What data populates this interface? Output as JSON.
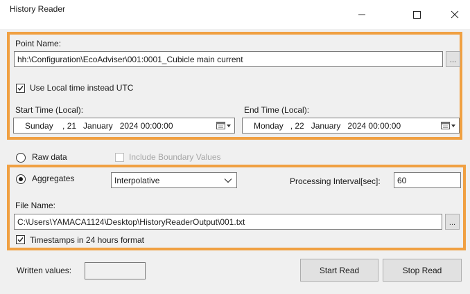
{
  "window": {
    "title": "History Reader",
    "controls": [
      "minimize-icon",
      "maximize-icon",
      "close-icon"
    ]
  },
  "point": {
    "label": "Point Name:",
    "value": "hh:\\Configuration\\EcoAdviser\\001:0001_Cubicle main current",
    "browse_label": "..."
  },
  "local_time": {
    "label": "Use Local time instead UTC",
    "checked": true
  },
  "start_time": {
    "label": "Start Time (Local):",
    "value": "Sunday    , 21   January   2024 00:00:00"
  },
  "end_time": {
    "label": "End Time (Local):",
    "value": "Monday   , 22   January   2024 00:00:00"
  },
  "raw_data": {
    "label": "Raw data",
    "selected": false
  },
  "boundary": {
    "label": "Include Boundary Values",
    "checked": false,
    "enabled": false
  },
  "aggregates": {
    "label": "Aggregates",
    "selected": true,
    "function": "Interpolative"
  },
  "interval": {
    "label": "Processing Interval[sec]:",
    "value": "60"
  },
  "file": {
    "label": "File Name:",
    "value": "C:\\Users\\YAMACA1124\\Desktop\\HistoryReaderOutput\\001.txt",
    "browse_label": "..."
  },
  "timestamps_24h": {
    "label": "Timestamps in 24 hours format",
    "checked": true
  },
  "written": {
    "label": "Written values:",
    "value": ""
  },
  "buttons": {
    "start": "Start Read",
    "stop": "Stop Read"
  },
  "colors": {
    "highlight": "#f0a042",
    "window_bg": "#f0f0f0",
    "titlebar_bg": "#ffffff"
  }
}
